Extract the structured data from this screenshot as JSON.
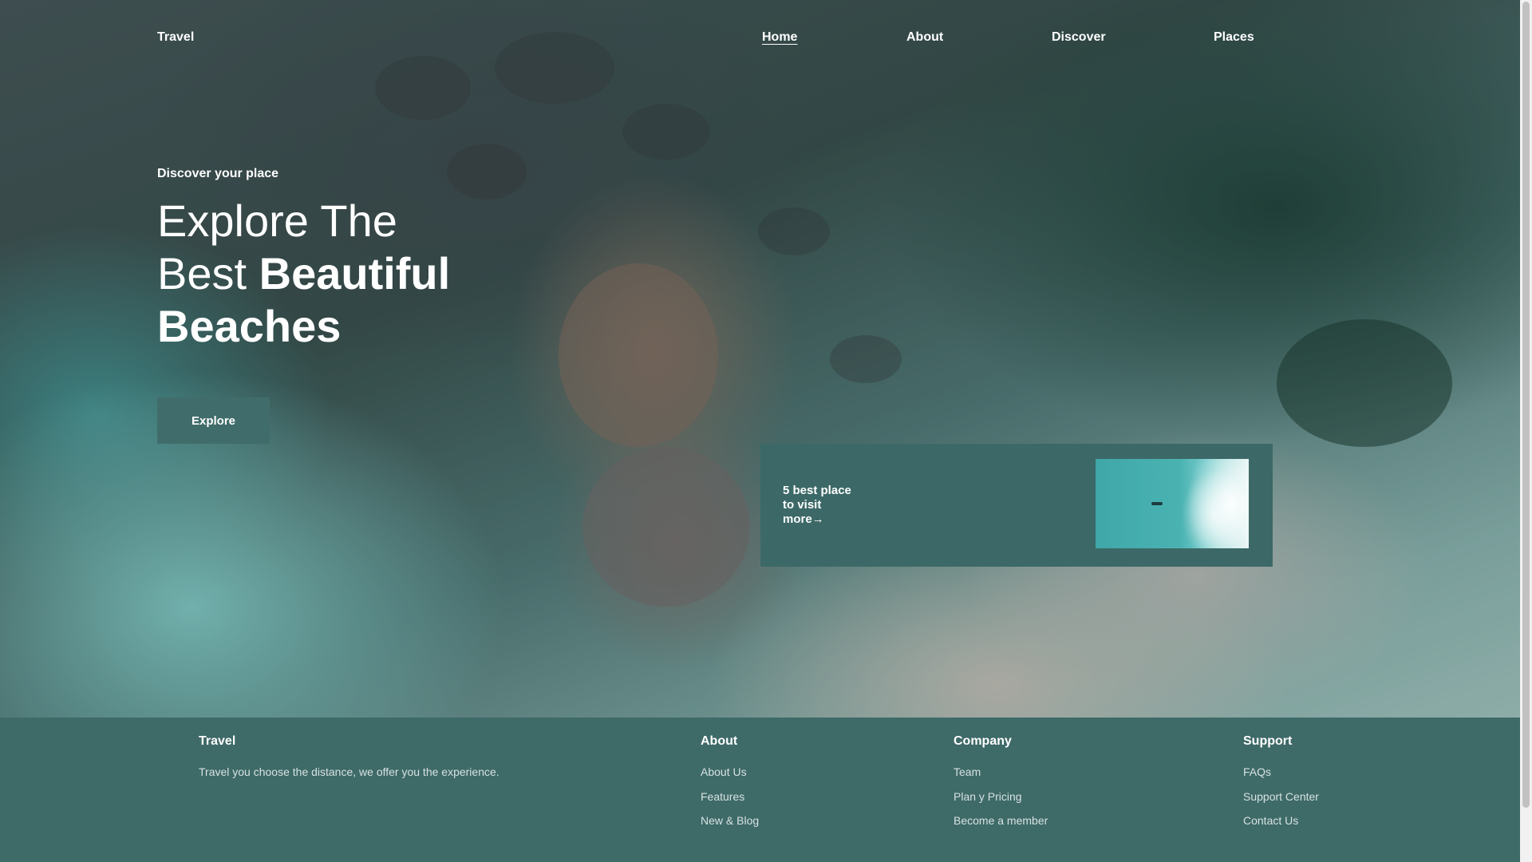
{
  "nav": {
    "brand": "Travel",
    "links": [
      "Home",
      "About",
      "Discover",
      "Places"
    ],
    "active": "Home"
  },
  "hero": {
    "eyebrow": "Discover your place",
    "headline_line1": "Explore The",
    "headline_line2_plain": "Best ",
    "headline_line2_bold": "Beautiful",
    "headline_line3_bold": "Beaches",
    "button": "Explore"
  },
  "promo": {
    "line1": "5 best place",
    "line2": "to visit",
    "more": "more→"
  },
  "footer": {
    "brand": "Travel",
    "tagline": "Travel you choose the distance, we offer you the experience.",
    "columns": [
      {
        "title": "About",
        "links": [
          "About Us",
          "Features",
          "New & Blog"
        ]
      },
      {
        "title": "Company",
        "links": [
          "Team",
          "Plan y Pricing",
          "Become a member"
        ]
      },
      {
        "title": "Support",
        "links": [
          "FAQs",
          "Support Center",
          "Contact Us"
        ]
      }
    ]
  },
  "colors": {
    "accent": "#406d6b",
    "footer_bg": "#3e6a68",
    "text": "#ffffff"
  }
}
